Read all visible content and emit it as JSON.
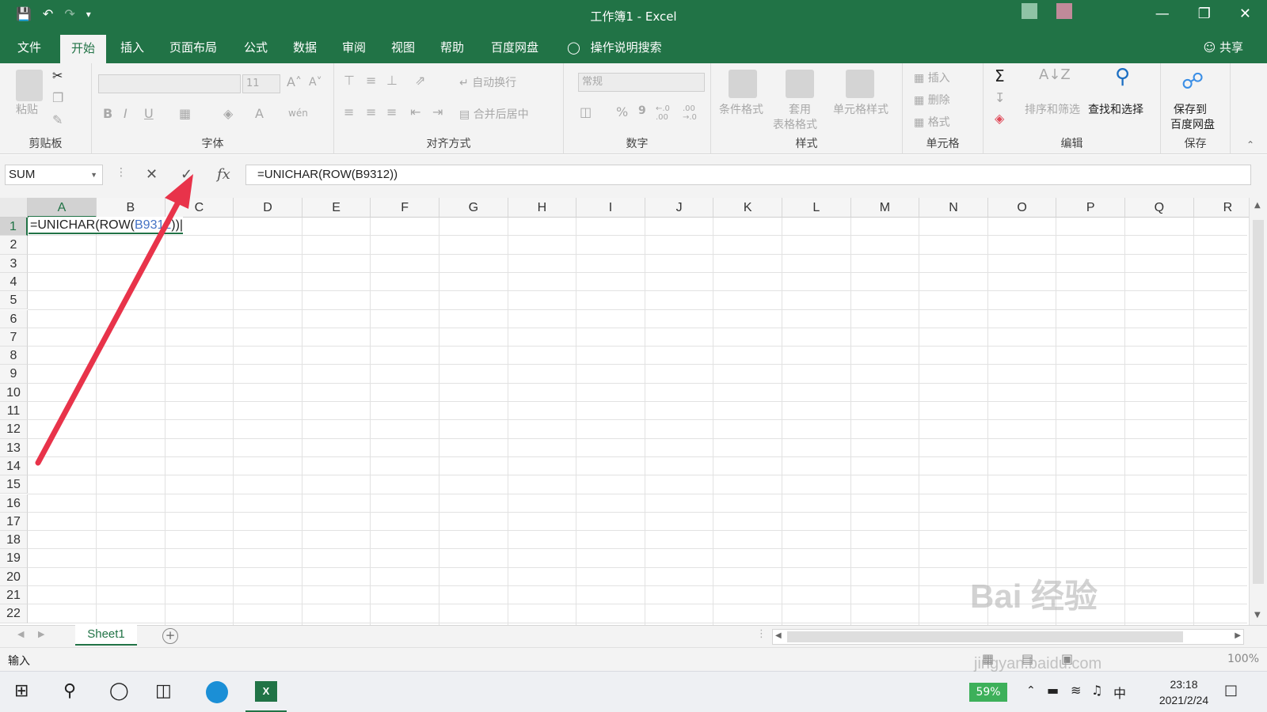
{
  "window": {
    "title": "工作簿1  -  Excel",
    "minimize_icon": "—",
    "restore_icon": "❐",
    "close_icon": "✕"
  },
  "quick_access": {
    "save_icon": "💾",
    "undo_icon": "↶",
    "redo_icon": "↷",
    "more_icon": "▾"
  },
  "menu": {
    "tabs": [
      "文件",
      "开始",
      "插入",
      "页面布局",
      "公式",
      "数据",
      "审阅",
      "视图",
      "帮助",
      "百度网盘"
    ],
    "active_tab": "开始",
    "tell_me": "操作说明搜索",
    "share": "共享"
  },
  "ribbon": {
    "clipboard": {
      "label": "剪贴板",
      "paste": "粘贴"
    },
    "font": {
      "label": "字体",
      "size": "11",
      "bold": "B",
      "italic": "I",
      "underline": "U",
      "grow": "A˄",
      "shrink": "A˅",
      "font_color": "A",
      "phonetic": "wén"
    },
    "alignment": {
      "label": "对齐方式",
      "wrap": "自动换行",
      "merge": "合并后居中"
    },
    "number": {
      "label": "数字",
      "format": "常规",
      "percent": "%",
      "comma": "9",
      "inc_dec": "←.0 .00",
      "dec_dec": ".00 →.0"
    },
    "styles": {
      "label": "样式",
      "conditional": "条件格式",
      "table_1": "套用",
      "table_2": "表格格式",
      "cell_styles": "单元格样式"
    },
    "cells": {
      "label": "单元格",
      "insert": "插入",
      "delete": "删除",
      "format": "格式"
    },
    "editing": {
      "label": "编辑",
      "sort": "排序和筛选",
      "find": "查找和选择"
    },
    "save": {
      "label": "保存",
      "save_1": "保存到",
      "save_2": "百度网盘"
    },
    "sum_icon": "Σ",
    "sort_icon": "A↓Z"
  },
  "formula_bar": {
    "name_box": "SUM",
    "cancel_icon": "✕",
    "enter_icon": "✓",
    "fx": "fx",
    "formula": "=UNICHAR(ROW(B9312))"
  },
  "grid": {
    "columns": [
      "A",
      "B",
      "C",
      "D",
      "E",
      "F",
      "G",
      "H",
      "I",
      "J",
      "K",
      "L",
      "M",
      "N",
      "O",
      "P",
      "Q",
      "R"
    ],
    "rows": [
      "1",
      "2",
      "3",
      "4",
      "5",
      "6",
      "7",
      "8",
      "9",
      "10",
      "11",
      "12",
      "13",
      "14",
      "15",
      "16",
      "17",
      "18",
      "19",
      "20",
      "21",
      "22"
    ],
    "active_cell_prefix": "=UNICHAR(ROW(",
    "active_cell_ref": "B9312",
    "active_cell_suffix": "))"
  },
  "sheets": {
    "tabs": [
      "Sheet1"
    ],
    "add_icon": "+"
  },
  "status": {
    "mode": "输入",
    "zoom": "100%"
  },
  "taskbar": {
    "battery": "59%",
    "ime": "中",
    "time": "23:18",
    "date": "2021/2/24"
  },
  "watermark": {
    "text": "Bai 经验",
    "url_text": "jingyan.baidu.com"
  },
  "colors": {
    "excel_green": "#217346",
    "annotation_arrow": "#e8334a",
    "ref_blue": "#4472c4"
  }
}
